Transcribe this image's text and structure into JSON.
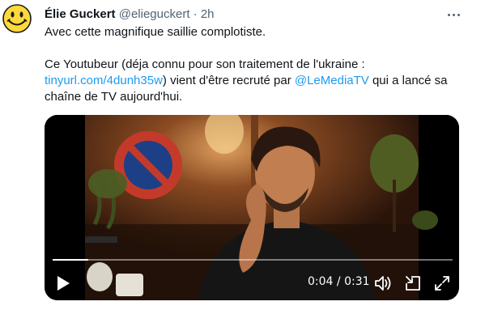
{
  "tweet": {
    "author_name": "Élie Guckert",
    "handle": "@elieguckert",
    "separator": "·",
    "time": "2h",
    "line1": "Avec cette magnifique saillie complotiste.",
    "line2a": "Ce Youtubeur (déja connu pour son traitement de l'ukraine :",
    "link_url": "tinyurl.com/4dunh35w",
    "line2b": ") vient d'être recruté par ",
    "mention": "@LeMediaTV",
    "line2c": " qui a lancé sa chaîne de TV aujourd'hui."
  },
  "video": {
    "current_time": "0:04",
    "time_separator": "/",
    "duration": "0:31",
    "progress_fraction": 0.09
  },
  "icons": {
    "avatar": "smiley-face-icon",
    "more": "more-dots-icon",
    "play": "play-icon",
    "volume": "volume-icon",
    "pip": "picture-in-picture-icon",
    "fullscreen": "fullscreen-icon"
  },
  "colors": {
    "link": "#1d9bf0",
    "secondary_text": "#536471",
    "avatar_yellow": "#ffd93b"
  }
}
